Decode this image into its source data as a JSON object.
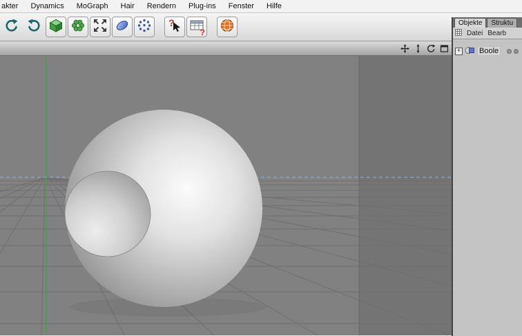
{
  "menu_bar": {
    "items": [
      "akter",
      "Dynamics",
      "MoGraph",
      "Hair",
      "Rendern",
      "Plug-ins",
      "Fenster",
      "Hilfe"
    ]
  },
  "toolbar": {
    "buttons": [
      "undo",
      "redo",
      "cube-primitive",
      "mograph-flower",
      "expand-arrows",
      "spline-pen",
      "point-cloud",
      "context-help",
      "content-browser",
      "online-updater"
    ],
    "help_glyph": "?",
    "browser_glyph": "?"
  },
  "viewport": {
    "controls": [
      "pan",
      "dolly",
      "rotate",
      "maximize"
    ],
    "colors": {
      "background": "#818181",
      "wall_band": "#747474",
      "grid": "#6e6e6e",
      "horizon_line": "#8fb4e2",
      "axis_line": "#3ba83b"
    }
  },
  "right_panel": {
    "tabs": [
      {
        "label": "Objekte",
        "active": true
      },
      {
        "label": "Struktu",
        "active": false
      }
    ],
    "menu_items": [
      "Datei",
      "Bearb"
    ],
    "objects": [
      {
        "label": "Boole",
        "expand_glyph": "+",
        "visibility_dots": 2
      }
    ]
  }
}
